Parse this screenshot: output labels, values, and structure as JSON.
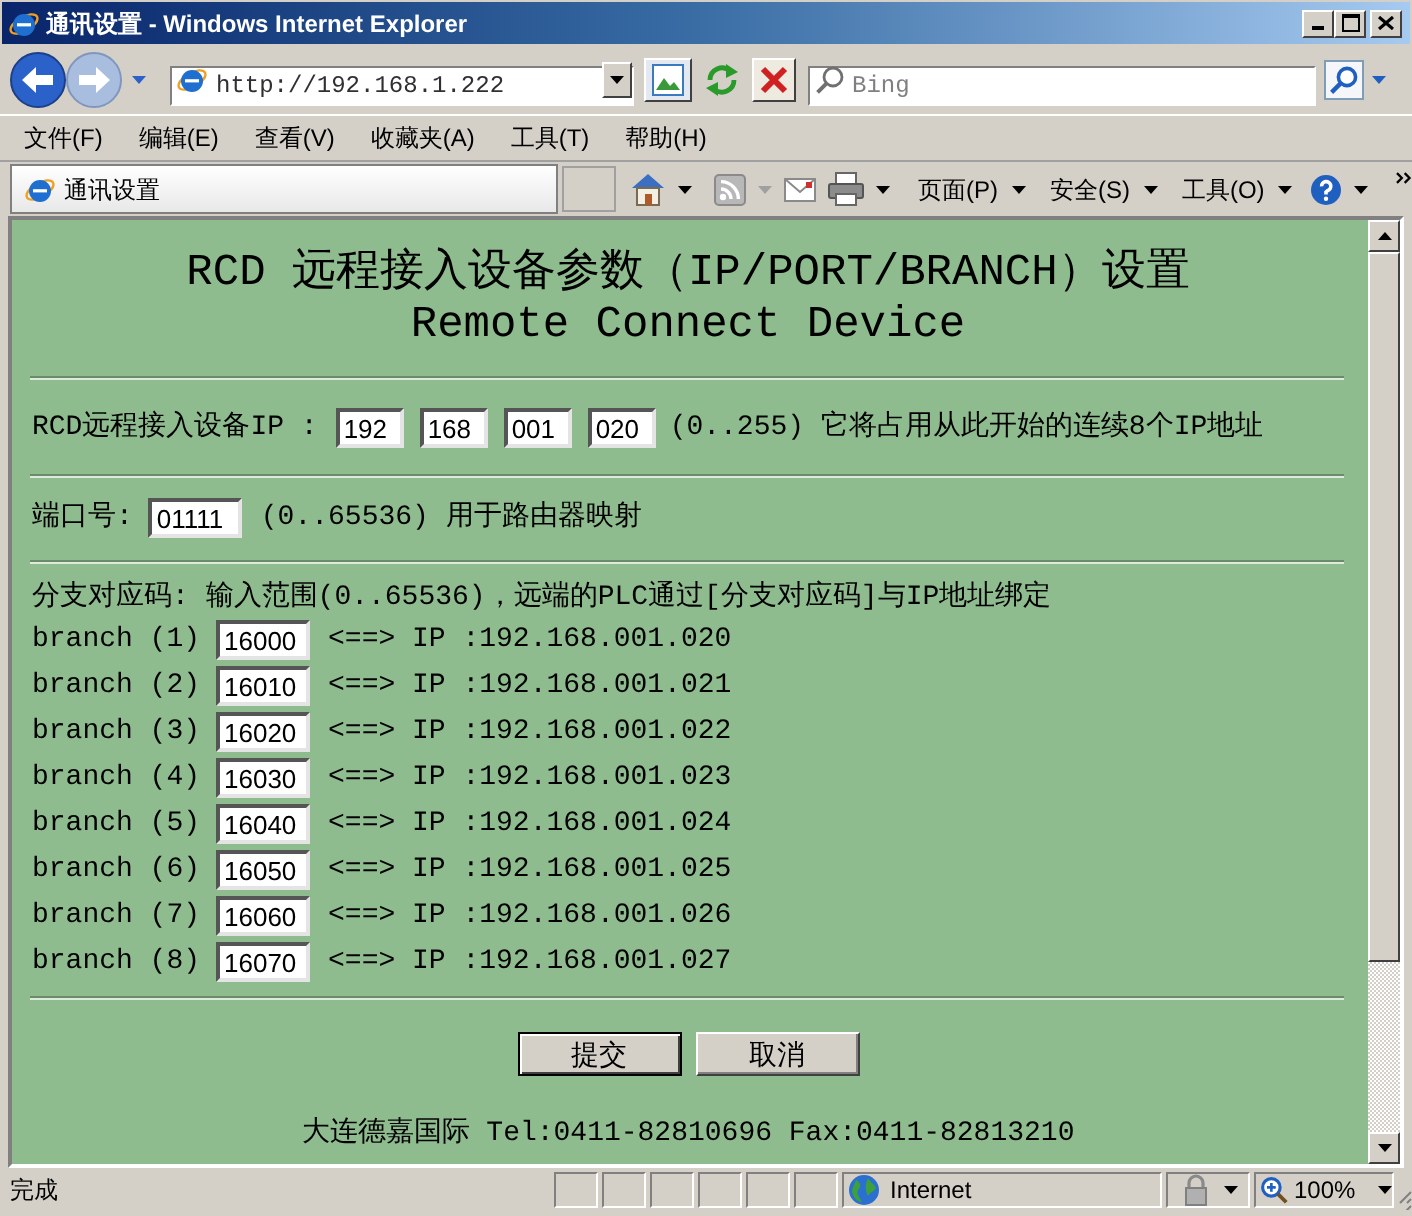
{
  "window": {
    "title": "通讯设置 - Windows Internet Explorer"
  },
  "address_bar": {
    "url": "http://192.168.1.222"
  },
  "search": {
    "placeholder": "Bing"
  },
  "menu_bar": [
    "文件(F)",
    "编辑(E)",
    "查看(V)",
    "收藏夹(A)",
    "工具(T)",
    "帮助(H)"
  ],
  "tabs": [
    {
      "label": "通讯设置",
      "selected": true
    }
  ],
  "command_bar": {
    "menus": [
      "页面(P)",
      "安全(S)",
      "工具(O)"
    ]
  },
  "page": {
    "title": "RCD 远程接入设备参数（IP/PORT/BRANCH）设置",
    "subtitle": "Remote Connect Device",
    "ip": {
      "label": "RCD远程接入设备IP :",
      "octets": [
        "192",
        "168",
        "001",
        "020"
      ],
      "hint": "(0..255) 它将占用从此开始的连续8个IP地址"
    },
    "port": {
      "label": "端口号:",
      "value": "01111",
      "hint": "(0..65536) 用于路由器映射"
    },
    "branches": {
      "heading": "分支对应码: 输入范围(0..65536)，远端的PLC通过[分支对应码]与IP地址绑定",
      "rows": [
        {
          "label": "branch (1)",
          "value": "16000",
          "mapping": "<==> IP :192.168.001.020"
        },
        {
          "label": "branch (2)",
          "value": "16010",
          "mapping": "<==> IP :192.168.001.021"
        },
        {
          "label": "branch (3)",
          "value": "16020",
          "mapping": "<==> IP :192.168.001.022"
        },
        {
          "label": "branch (4)",
          "value": "16030",
          "mapping": "<==> IP :192.168.001.023"
        },
        {
          "label": "branch (5)",
          "value": "16040",
          "mapping": "<==> IP :192.168.001.024"
        },
        {
          "label": "branch (6)",
          "value": "16050",
          "mapping": "<==> IP :192.168.001.025"
        },
        {
          "label": "branch (7)",
          "value": "16060",
          "mapping": "<==> IP :192.168.001.026"
        },
        {
          "label": "branch (8)",
          "value": "16070",
          "mapping": "<==> IP :192.168.001.027"
        }
      ]
    },
    "buttons": [
      {
        "label": "提交",
        "default": true
      },
      {
        "label": "取消",
        "default": false
      }
    ],
    "footer": "大连德嘉国际 Tel:0411-82810696 Fax:0411-82813210"
  },
  "status_bar": {
    "text": "完成",
    "zone": "Internet",
    "zoom": "100%"
  }
}
